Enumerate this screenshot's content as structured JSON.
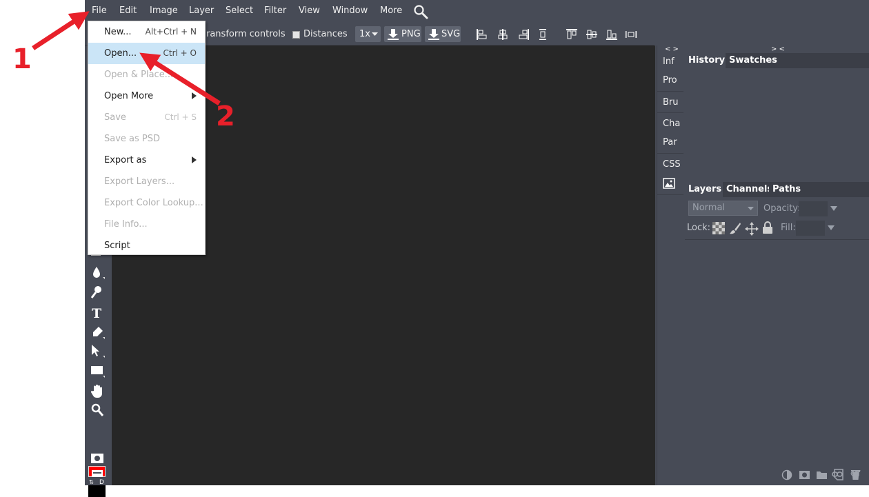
{
  "menubar": {
    "items": [
      "File",
      "Edit",
      "Image",
      "Layer",
      "Select",
      "Filter",
      "View",
      "Window",
      "More"
    ]
  },
  "options": {
    "transform_label": "ransform controls",
    "distances_label": "Distances",
    "scale_label": "1x",
    "png_label": "PNG",
    "svg_label": "SVG"
  },
  "file_menu": {
    "items": [
      {
        "label": "New...",
        "shortcut": "Alt+Ctrl + N",
        "enabled": true
      },
      {
        "label": "Open...",
        "shortcut": "Ctrl + O",
        "enabled": true,
        "highlighted": true
      },
      {
        "label": "Open & Place...",
        "shortcut": "",
        "enabled": false
      },
      {
        "label": "Open More",
        "shortcut": "",
        "enabled": true,
        "submenu": true
      },
      {
        "label": "Save",
        "shortcut": "Ctrl + S",
        "enabled": false
      },
      {
        "label": "Save as PSD",
        "shortcut": "",
        "enabled": false
      },
      {
        "label": "Export as",
        "shortcut": "",
        "enabled": true,
        "submenu": true
      },
      {
        "label": "Export Layers...",
        "shortcut": "",
        "enabled": false
      },
      {
        "label": "Export Color Lookup...",
        "shortcut": "",
        "enabled": false
      },
      {
        "label": "File Info...",
        "shortcut": "",
        "enabled": false
      },
      {
        "label": "Script",
        "shortcut": "",
        "enabled": true
      }
    ]
  },
  "strip": {
    "collapse": "< >",
    "items": [
      "Inf",
      "Pro",
      "Bru",
      "Cha",
      "Par",
      "CSS"
    ]
  },
  "history_panel": {
    "collapse": "> <",
    "tabs": [
      "History",
      "Swatches"
    ]
  },
  "layers_panel": {
    "tabs": [
      "Layers",
      "Channels",
      "Paths"
    ],
    "blend_mode": "Normal",
    "opacity_label": "Opacity:",
    "lock_label": "Lock:",
    "fill_label": "Fill:",
    "footer_eff": "eff"
  },
  "toolbar": {
    "swap_label": "⇅",
    "default_label": "D",
    "fg_color": "#ff0000",
    "bg_color": "#000000"
  },
  "annotations": {
    "step1": "1",
    "step2": "2",
    "arrow_color": "#e8202a"
  }
}
